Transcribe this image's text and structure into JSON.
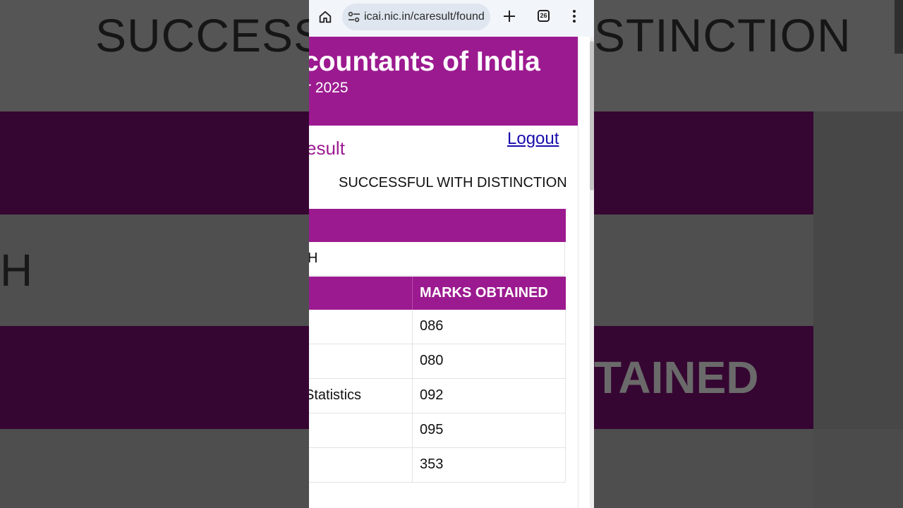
{
  "background": {
    "title_left": "SUCCESSF",
    "title_right": "STINCTION",
    "name_fragment": "H",
    "marks_fragment": "TAINED"
  },
  "browser": {
    "url": "icai.nic.in/caresult/found",
    "tab_count": "26"
  },
  "banner": {
    "title": "countants of India",
    "subtitle": "r 2025"
  },
  "page": {
    "heading": "esult",
    "logout_label": "Logout",
    "status": "SUCCESSFUL WITH DISTINCTION",
    "name_fragment": "H"
  },
  "marks_table": {
    "header_marks": "MARKS OBTAINED",
    "rows": [
      {
        "subject": "",
        "marks": "086"
      },
      {
        "subject": "",
        "marks": "080"
      },
      {
        "subject": "Statistics",
        "marks": "092"
      },
      {
        "subject": "",
        "marks": "095"
      },
      {
        "subject": "",
        "marks": "353"
      }
    ]
  },
  "colors": {
    "brand_purple": "#9c1a90",
    "link_blue": "#1a0dab"
  }
}
